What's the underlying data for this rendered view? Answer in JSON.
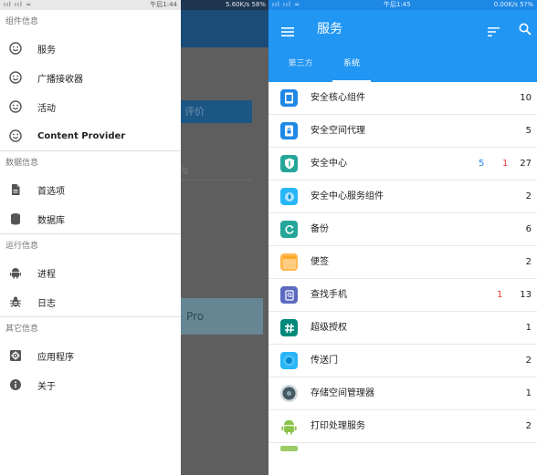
{
  "left_screen": {
    "status": {
      "signal": "ııl ııl ≈",
      "time": "午后1:44",
      "net": "5.60K/s 58%"
    },
    "background_app": {
      "button_text": "评价",
      "line_text": "址",
      "card_text": "Pro"
    },
    "drawer": {
      "sections": [
        {
          "title": "组件信息",
          "items": [
            {
              "label": "服务",
              "icon": "smiley-icon"
            },
            {
              "label": "广播接收器",
              "icon": "smiley-icon"
            },
            {
              "label": "活动",
              "icon": "smiley-icon"
            },
            {
              "label": "Content Provider",
              "icon": "smiley-icon"
            }
          ]
        },
        {
          "title": "数据信息",
          "items": [
            {
              "label": "首选项",
              "icon": "document-icon"
            },
            {
              "label": "数据库",
              "icon": "database-icon"
            }
          ]
        },
        {
          "title": "运行信息",
          "items": [
            {
              "label": "进程",
              "icon": "android-icon"
            },
            {
              "label": "日志",
              "icon": "bug-icon"
            }
          ]
        },
        {
          "title": "其它信息",
          "items": [
            {
              "label": "应用程序",
              "icon": "settings-box-icon"
            },
            {
              "label": "关于",
              "icon": "info-icon"
            }
          ]
        }
      ]
    }
  },
  "right_screen": {
    "status": {
      "signal": "ııl ııl ≈",
      "time": "午后1:45",
      "net": "0.00K/s 5?%"
    },
    "appbar": {
      "title": "服务",
      "icons": [
        "menu-icon",
        "sort-icon",
        "search-icon"
      ]
    },
    "tabs": [
      {
        "label": "第三方",
        "active": false
      },
      {
        "label": "系统",
        "active": true
      }
    ],
    "rows": [
      {
        "name": "安全核心组件",
        "count": "10",
        "blue": "",
        "red": "",
        "icon_color": "#1e88e5",
        "icon": "shield-doc-icon"
      },
      {
        "name": "安全空间代理",
        "count": "5",
        "blue": "",
        "red": "",
        "icon_color": "#1e88e5",
        "icon": "doc-lock-icon"
      },
      {
        "name": "安全中心",
        "count": "27",
        "blue": "5",
        "red": "1",
        "icon_color": "#26a69a",
        "icon": "shield-icon"
      },
      {
        "name": "安全中心服务组件",
        "count": "2",
        "blue": "",
        "red": "",
        "icon_color": "#29b6f6",
        "icon": "drop-icon"
      },
      {
        "name": "备份",
        "count": "6",
        "blue": "",
        "red": "",
        "icon_color": "#26a69a",
        "icon": "refresh-icon"
      },
      {
        "name": "便签",
        "count": "2",
        "blue": "",
        "red": "",
        "icon_color": "#ffb74d",
        "icon": "note-icon"
      },
      {
        "name": "查找手机",
        "count": "13",
        "blue": "",
        "red": "1",
        "icon_color": "#5c6bc0",
        "icon": "find-phone-icon"
      },
      {
        "name": "超级授权",
        "count": "1",
        "blue": "",
        "red": "",
        "icon_color": "#00897b",
        "icon": "hash-icon"
      },
      {
        "name": "传送门",
        "count": "2",
        "blue": "",
        "red": "",
        "icon_color": "#29b6f6",
        "icon": "portal-icon"
      },
      {
        "name": "存储空间管理器",
        "count": "1",
        "blue": "",
        "red": "",
        "icon_color": "#455a64",
        "icon": "storage-icon"
      },
      {
        "name": "打印处理服务",
        "count": "2",
        "blue": "",
        "red": "",
        "icon_color": "#8bc34a",
        "icon": "android-green-icon"
      }
    ]
  },
  "colors": {
    "primary": "#2196f3",
    "primary_dark": "#1e88e5",
    "scrim": "#5e5e5e",
    "accent_red": "#e53935"
  }
}
